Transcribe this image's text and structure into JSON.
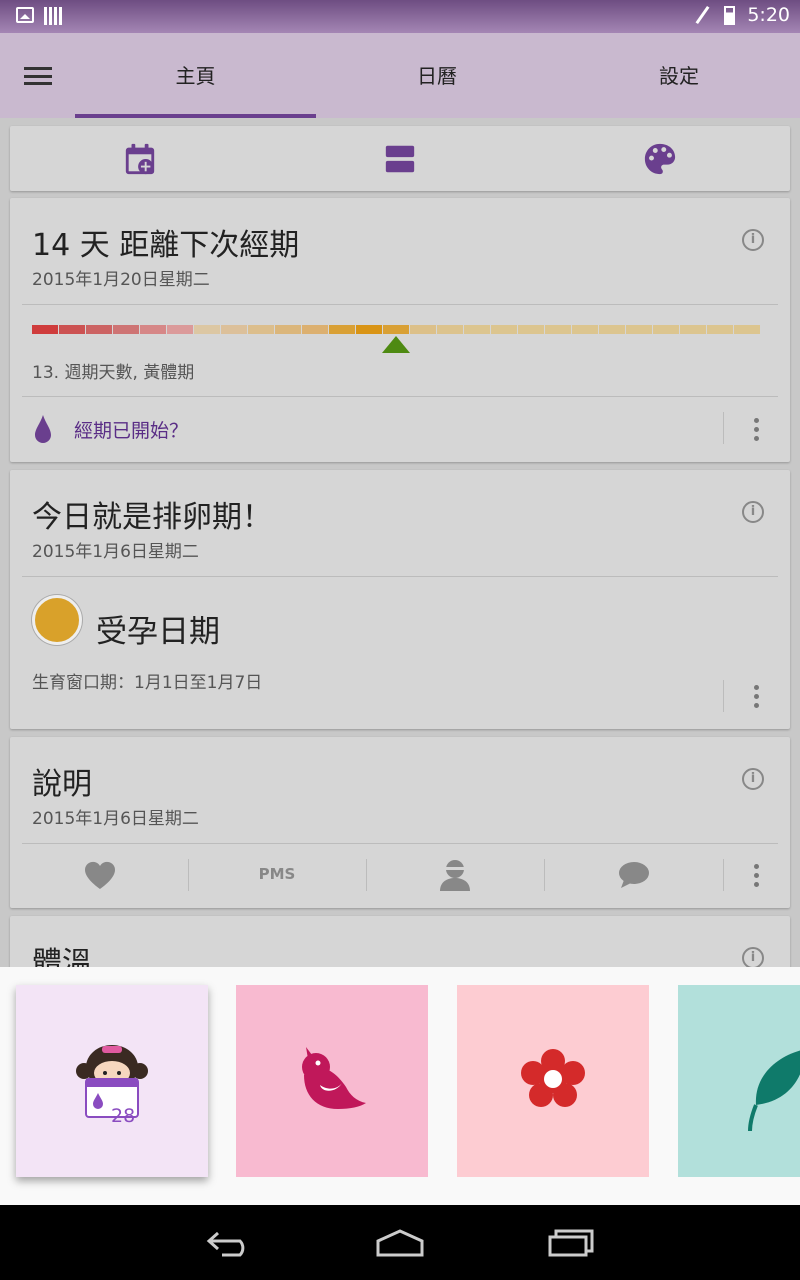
{
  "status_bar": {
    "time": "5:20"
  },
  "tabs": [
    "主頁",
    "日曆",
    "設定"
  ],
  "colors": {
    "accent": "#6a3f8e",
    "appbar": "#c9b9cf",
    "card": "#d6d6d6",
    "fertile": "#d9a12a",
    "marker": "#4e8a12"
  },
  "toolbar_icons": [
    "calendar-add-icon",
    "view-agenda-icon",
    "palette-icon"
  ],
  "next_period_card": {
    "days": "14",
    "title_suffix": "天 距離下次經期",
    "date": "2015年1月20日星期二",
    "cycle_info": "13. 週期天數, 黃體期",
    "period_started_action": "經期已開始？",
    "cycle_day_current": 13,
    "cycle_length": 27,
    "segment_colors": [
      "#cf3c3c",
      "#cc5252",
      "#cc6363",
      "#ce7474",
      "#d68787",
      "#db9a9a",
      "#dcc7a3",
      "#dcc09a",
      "#dcbe8c",
      "#dbb67b",
      "#dcb070",
      "#d9a035",
      "#d99415",
      "#d9a035",
      "#dcc089",
      "#dcc38d",
      "#dcc58f",
      "#dcc58f",
      "#dcc58f",
      "#dcc58f",
      "#dcc58f",
      "#dcc58f",
      "#dcc58f",
      "#dcc58f",
      "#dcc58f",
      "#dcc58f",
      "#dcc58f"
    ]
  },
  "ovulation_card": {
    "title": "今日就是排卵期！",
    "date": "2015年1月6日星期二",
    "status": "受孕日期",
    "fertile_window": "生育窗口期：1月1日至1月7日"
  },
  "notes_card": {
    "title": "說明",
    "date": "2015年1月6日星期二",
    "actions": [
      "heart-icon",
      "PMS",
      "person-icon",
      "chat-icon"
    ]
  },
  "temperature_card": {
    "title": "體溫"
  },
  "themes": [
    {
      "name": "app-logo-theme",
      "bg": "#f3e4f6",
      "label": "28"
    },
    {
      "name": "bird-theme",
      "bg": "#f8bad0"
    },
    {
      "name": "flower-theme",
      "bg": "#fdccd2"
    },
    {
      "name": "leaf-theme",
      "bg": "#b2e0db"
    }
  ]
}
